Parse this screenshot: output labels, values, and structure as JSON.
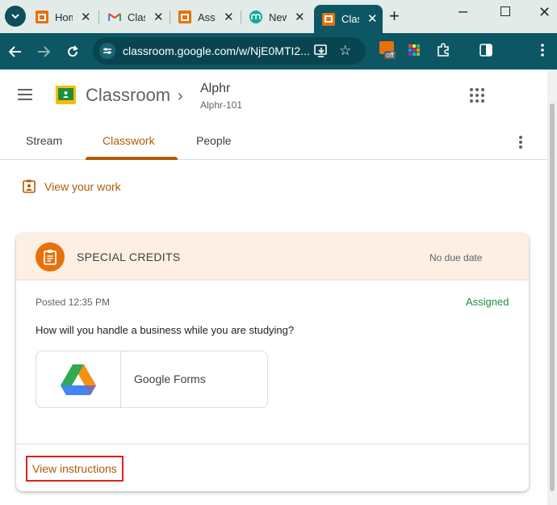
{
  "browser": {
    "tabs": [
      {
        "title": "Home",
        "favicon": "classroom-icon",
        "active": false
      },
      {
        "title": "Classroom",
        "favicon": "gmail-icon",
        "active": false
      },
      {
        "title": "Assignments",
        "favicon": "classroom-icon",
        "active": false
      },
      {
        "title": "New",
        "favicon": "m-icon",
        "active": false
      },
      {
        "title": "Classwork",
        "favicon": "classroom-icon",
        "active": true
      }
    ],
    "close_glyph": "✕",
    "new_tab_glyph": "+",
    "url": "classroom.google.com/w/NjE0MTI2...",
    "extension_badge": "off"
  },
  "header": {
    "app_name": "Classroom",
    "class_name": "Alphr",
    "class_section": "Alphr-101"
  },
  "nav": {
    "tabs": [
      "Stream",
      "Classwork",
      "People"
    ],
    "active_tab": "Classwork"
  },
  "view_work_label": "View your work",
  "assignment": {
    "title": "SPECIAL CREDITS",
    "due": "No due date",
    "posted": "Posted 12:35 PM",
    "status": "Assigned",
    "question": "How will you handle a business while you are studying?",
    "attachment_label": "Google Forms",
    "view_instructions_label": "View instructions"
  },
  "colors": {
    "accent": "#b15b06",
    "assignment_orange": "#e8710a",
    "status_green": "#1e8e3e",
    "chrome_teal": "#0d5663"
  }
}
